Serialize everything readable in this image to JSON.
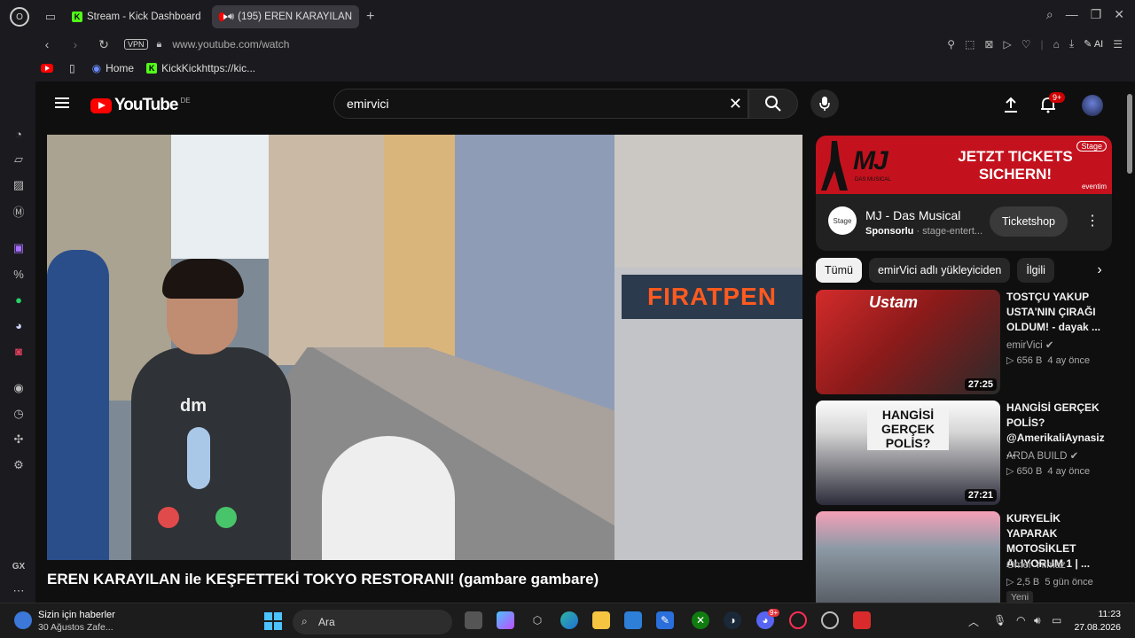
{
  "browser": {
    "tabs": [
      {
        "label": "Stream - Kick Dashboard",
        "active": false
      },
      {
        "label": "(195) EREN KARAYILAN",
        "active": true
      }
    ],
    "url": "www.youtube.com/watch",
    "vpn_label": "VPN",
    "ai_label": "AI",
    "bookmarks": [
      {
        "label": "Home"
      },
      {
        "label": "KickKickhttps://kic..."
      }
    ],
    "sidebar_gx_label": "GX"
  },
  "youtube": {
    "logo_text": "YouTube",
    "country_code": "DE",
    "search_query": "emirvici",
    "notification_count": "9+",
    "video_title": "EREN KARAYILAN ile KEŞFETTEKİ TOKYO RESTORANI! (gambare gambare)",
    "ad": {
      "banner_brand": "MJ",
      "banner_brand_sub": "DAS MUSICAL",
      "banner_headline": "JETZT TICKETS SICHERN!",
      "banner_stage": "Stage",
      "banner_eventim": "eventim",
      "logo_text": "Stage",
      "name": "MJ - Das Musical",
      "sponsored": "Sponsorlu",
      "advertiser": "stage-entert...",
      "cta": "Ticketshop"
    },
    "chips": [
      "Tümü",
      "emirVici adlı yükleyiciden",
      "İlgili"
    ],
    "recommendations": [
      {
        "title": "TOSTÇU YAKUP USTA'NIN ÇIRAĞI OLDUM! - dayak ...",
        "channel": "emirVici",
        "verified": true,
        "views": "656 B",
        "age": "4 ay önce",
        "duration": "27:25",
        "thumb_text": "Ustam"
      },
      {
        "title": "HANGİSİ GERÇEK POLİS? @AmerikaliAynasiz ...",
        "channel": "ARDA BUILD",
        "verified": true,
        "views": "650 B",
        "age": "4 ay önce",
        "duration": "27:21",
        "thumb_text": "HANGİSİ GERÇEK POLİS?"
      },
      {
        "title": "KURYELİK YAPARAK MOTOSİKLET ALIYORUM 1 | ...",
        "channel": "Ömer Yılmaz",
        "verified": false,
        "views": "2,5 B",
        "age": "5 gün önce",
        "badge": "Yeni",
        "duration": "",
        "thumb_text": ""
      }
    ]
  },
  "video_scene": {
    "shop_sign": "FIRATPEN",
    "shirt_text": "dm"
  },
  "taskbar": {
    "news_title": "Sizin için haberler",
    "news_sub": "30 Ağustos Zafe...",
    "search_placeholder": "Ara",
    "time": "11:23",
    "date": "27.08.2026",
    "discord_badge": "9+"
  },
  "colors": {
    "youtube_red": "#ff0000",
    "kick_green": "#53fc18",
    "ad_red": "#c3121e",
    "windows_accent": "#4cc2ff"
  }
}
